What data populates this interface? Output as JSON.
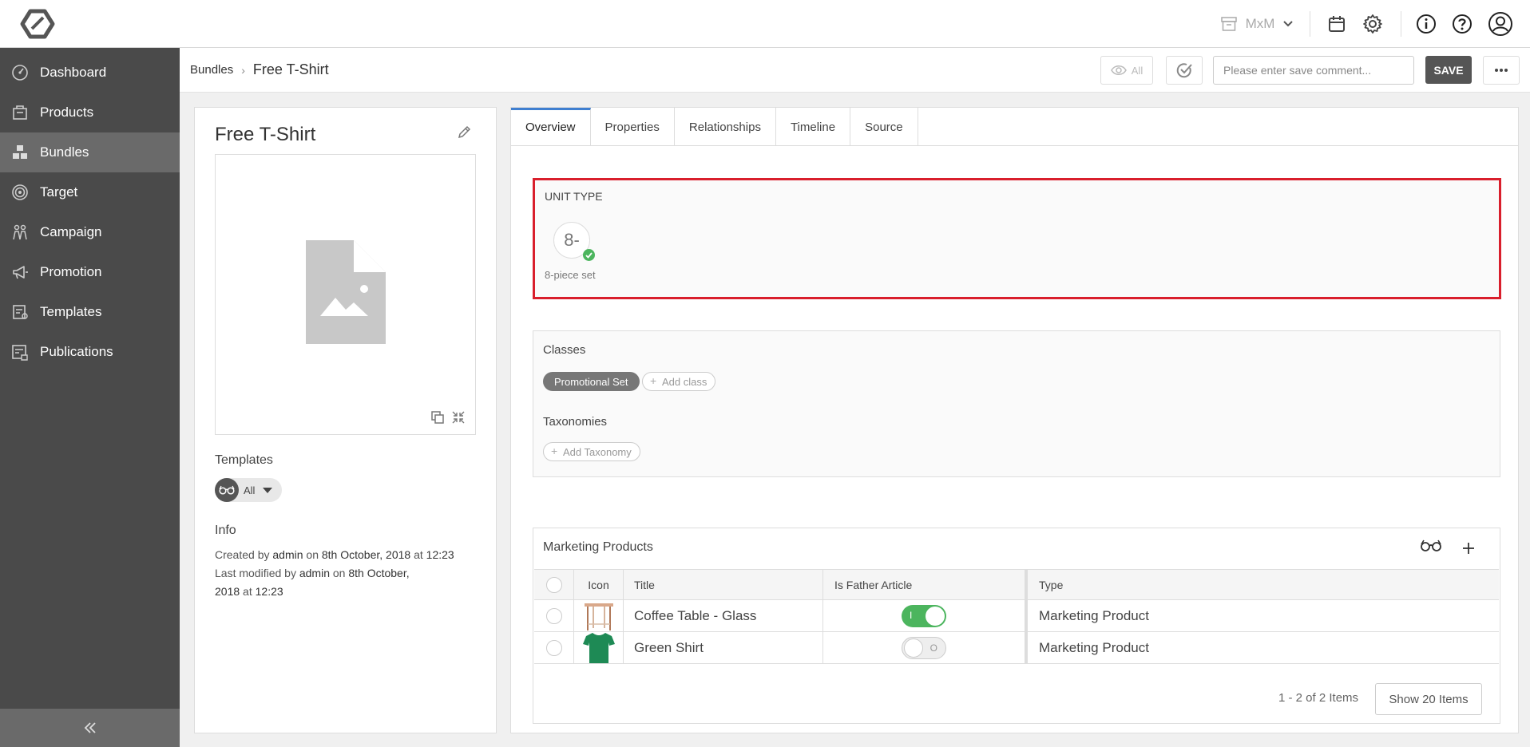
{
  "topbar": {
    "org_switcher": "MxM"
  },
  "sidebar": {
    "items": [
      {
        "label": "Dashboard",
        "icon": "dashboard-icon"
      },
      {
        "label": "Products",
        "icon": "products-icon"
      },
      {
        "label": "Bundles",
        "icon": "bundles-icon",
        "active": true
      },
      {
        "label": "Target",
        "icon": "target-icon"
      },
      {
        "label": "Campaign",
        "icon": "campaign-icon"
      },
      {
        "label": "Promotion",
        "icon": "megaphone-icon"
      },
      {
        "label": "Templates",
        "icon": "templates-icon"
      },
      {
        "label": "Publications",
        "icon": "publications-icon"
      }
    ]
  },
  "subheader": {
    "breadcrumb_parent": "Bundles",
    "breadcrumb_separator": "›",
    "breadcrumb_current": "Free T-Shirt",
    "view_all_label": "All",
    "comment_placeholder": "Please enter save comment...",
    "save_label": "SAVE"
  },
  "left": {
    "title": "Free T-Shirt",
    "templates_heading": "Templates",
    "templates_filter": "All",
    "info_heading": "Info",
    "created_prefix": "Created by",
    "created_by": "admin",
    "on1": "on",
    "created_date": "8th October, 2018",
    "at1": "at",
    "created_time": "12:23",
    "modified_prefix": "Last modified by",
    "modified_by": "admin",
    "on2": "on",
    "modified_date_part1": "8th October,",
    "modified_date_part2": "2018",
    "at2": "at",
    "modified_time": "12:23"
  },
  "tabs": [
    "Overview",
    "Properties",
    "Relationships",
    "Timeline",
    "Source"
  ],
  "unit_type": {
    "heading": "UNIT TYPE",
    "chip_text": "8-",
    "caption": "8-piece set"
  },
  "classes": {
    "heading": "Classes",
    "items": [
      "Promotional Set"
    ],
    "add_label": "Add class",
    "taxonomies_heading": "Taxonomies",
    "add_taxonomy_label": "Add Taxonomy"
  },
  "marketing_products": {
    "heading": "Marketing Products",
    "columns": [
      "Icon",
      "Title",
      "Is Father Article",
      "Type"
    ],
    "rows": [
      {
        "title": "Coffee Table - Glass",
        "is_father": true,
        "toggle_label": "I",
        "type": "Marketing Product"
      },
      {
        "title": "Green Shirt",
        "is_father": false,
        "toggle_label": "O",
        "type": "Marketing Product"
      }
    ],
    "pager_text": "1 - 2 of 2 Items",
    "show_items_label": "Show 20 Items"
  },
  "colors": {
    "sidebar_bg": "#4a4a4a",
    "sidebar_active": "#6a6a6a",
    "highlight_border": "#d91f2c",
    "toggle_on": "#4cb55e",
    "tab_accent": "#3f7fd0"
  }
}
